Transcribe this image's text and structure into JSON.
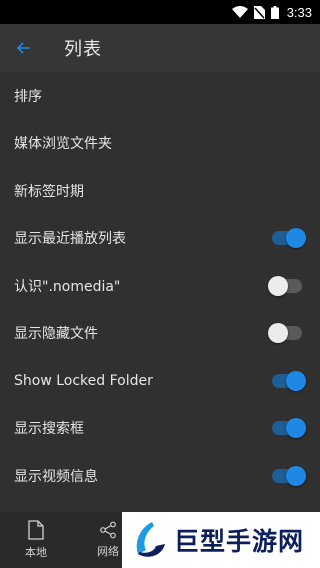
{
  "status": {
    "time": "3:33"
  },
  "toolbar": {
    "title": "列表"
  },
  "settings": [
    {
      "label": "排序"
    },
    {
      "label": "媒体浏览文件夹"
    },
    {
      "label": "新标签时期"
    },
    {
      "label": "显示最近播放列表",
      "toggle": "on"
    },
    {
      "label": "认识\".nomedia\"",
      "toggle": "off"
    },
    {
      "label": "显示隐藏文件",
      "toggle": "off"
    },
    {
      "label": "Show Locked Folder",
      "toggle": "on"
    },
    {
      "label": "显示搜索框",
      "toggle": "on"
    },
    {
      "label": "显示视频信息",
      "toggle": "on"
    }
  ],
  "bottom_nav": {
    "local": "本地",
    "network": "网络"
  },
  "watermark": {
    "text": "巨型手游网"
  },
  "colors": {
    "accent": "#1e88e5",
    "background": "#303030",
    "toolbar": "#363636"
  }
}
